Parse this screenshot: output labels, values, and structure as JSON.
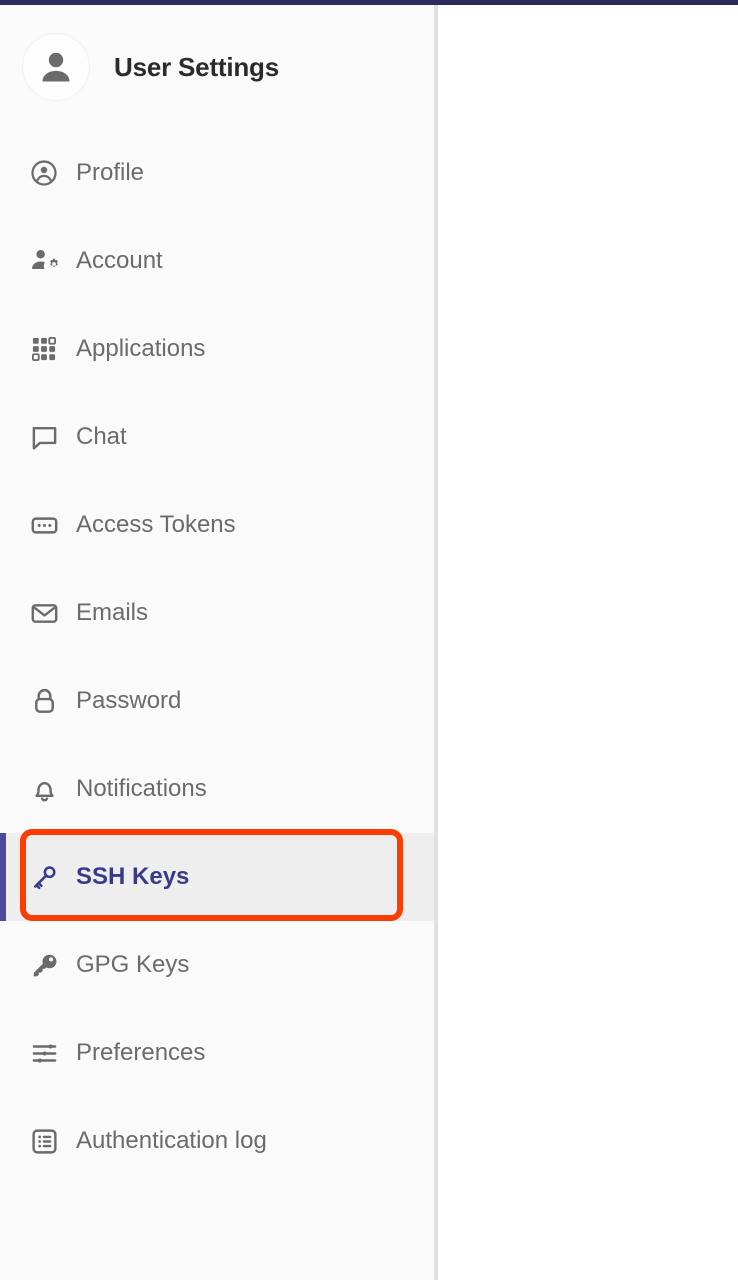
{
  "theme": {
    "top_bar_color": "#2b2b5e",
    "sidebar_bg": "#fafafa",
    "active_bg": "#eeeeee",
    "active_accent": "#4a4a9e",
    "active_text": "#3a3a8c",
    "label_color": "#6b6b6b",
    "title_color": "#2b2b2b",
    "annotation_color": "#f93d04",
    "divider_color": "#e0e0e0"
  },
  "sidebar": {
    "title": "User Settings",
    "avatar_icon": "user-avatar-icon",
    "items": [
      {
        "label": "Profile",
        "icon": "user-circle-icon",
        "active": false
      },
      {
        "label": "Account",
        "icon": "user-gear-icon",
        "active": false
      },
      {
        "label": "Applications",
        "icon": "grid-apps-icon",
        "active": false
      },
      {
        "label": "Chat",
        "icon": "speech-bubble-icon",
        "active": false
      },
      {
        "label": "Access Tokens",
        "icon": "token-dots-icon",
        "active": false
      },
      {
        "label": "Emails",
        "icon": "envelope-icon",
        "active": false
      },
      {
        "label": "Password",
        "icon": "lock-icon",
        "active": false
      },
      {
        "label": "Notifications",
        "icon": "bell-icon",
        "active": false
      },
      {
        "label": "SSH Keys",
        "icon": "key-outline-icon",
        "active": true
      },
      {
        "label": "GPG Keys",
        "icon": "key-solid-icon",
        "active": false
      },
      {
        "label": "Preferences",
        "icon": "sliders-icon",
        "active": false
      },
      {
        "label": "Authentication log",
        "icon": "list-box-icon",
        "active": false
      }
    ]
  },
  "content": {
    "body_text": ""
  }
}
